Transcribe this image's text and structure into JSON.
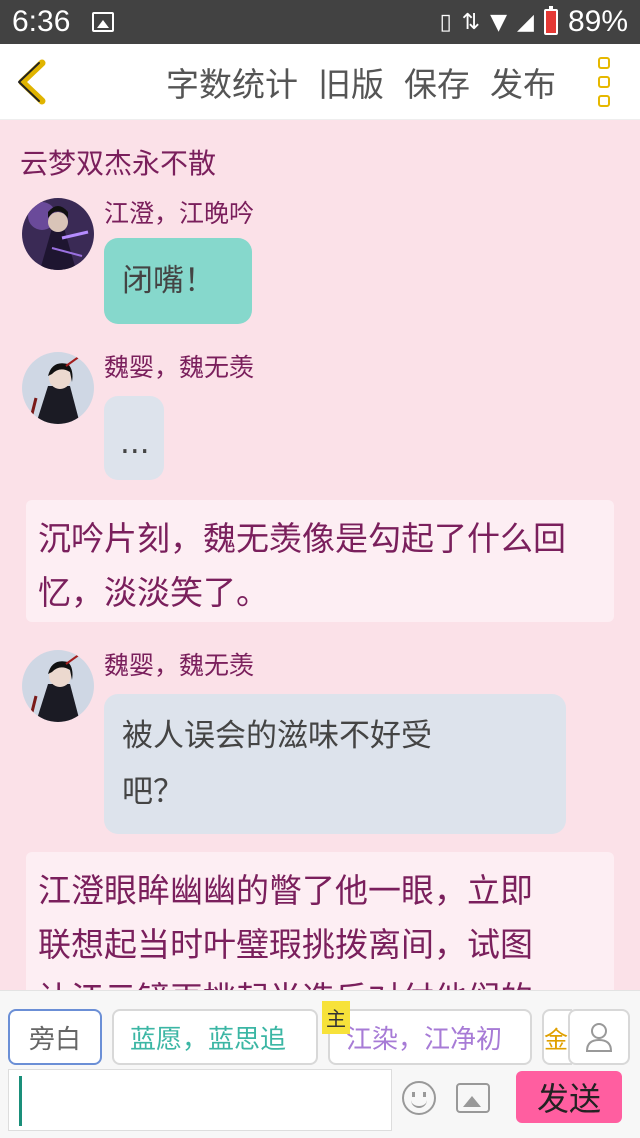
{
  "status_bar": {
    "time": "6:36",
    "battery_pct": "89%"
  },
  "toolbar": {
    "word_count": "字数统计",
    "old_version": "旧版",
    "save": "保存",
    "publish": "发布"
  },
  "story": {
    "title": "云梦双杰永不散"
  },
  "messages": [
    {
      "speaker": "江澄，江晚吟",
      "text": "闭嘴！"
    },
    {
      "speaker": "魏婴，魏无羡",
      "text": "..."
    },
    {
      "narration": "沉吟片刻，魏无羡像是勾起了什么回忆，淡淡笑了。"
    },
    {
      "speaker": "魏婴，魏无羡",
      "text_line1": "被人误会的滋味不好受",
      "text_line2": "吧？"
    },
    {
      "narration_line1": "江澄眼眸幽幽的瞥了他一眼，立即",
      "narration_line2": "联想起当时叶璧瑕挑拨离间，试图",
      "narration_line3": "让江云镜再挑起半造反对付他们的"
    }
  ],
  "roles": {
    "narration": "旁白",
    "role1": "蓝愿，蓝思追",
    "main_tag": "主",
    "role2": "江染，江净初",
    "role3_partial": "金"
  },
  "composer": {
    "send": "发送"
  },
  "colors": {
    "accent_pink": "#ff5ea0",
    "teal_bubble": "#86d8cc",
    "grey_bubble": "#dde3ec",
    "title_purple": "#7a1f5c"
  }
}
